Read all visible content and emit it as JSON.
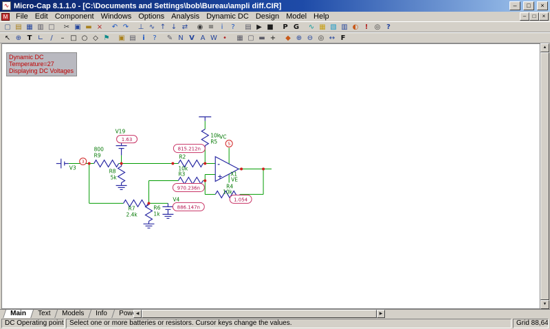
{
  "window": {
    "title": "Micro-Cap 8.1.1.0 - [C:\\Documents and Settings\\bob\\Bureau\\ampli diff.CIR]",
    "icon_glyph": "∿",
    "child_icon_glyph": "M",
    "controls": {
      "minimize": "–",
      "restore": "□",
      "close": "×"
    }
  },
  "menu": {
    "items": [
      {
        "label": "File",
        "name": "menu-file"
      },
      {
        "label": "Edit",
        "name": "menu-edit"
      },
      {
        "label": "Component",
        "name": "menu-component"
      },
      {
        "label": "Windows",
        "name": "menu-windows"
      },
      {
        "label": "Options",
        "name": "menu-options"
      },
      {
        "label": "Analysis",
        "name": "menu-analysis"
      },
      {
        "label": "Dynamic DC",
        "name": "menu-dynamic-dc"
      },
      {
        "label": "Design",
        "name": "menu-design"
      },
      {
        "label": "Model",
        "name": "menu-model"
      },
      {
        "label": "Help",
        "name": "menu-help"
      }
    ]
  },
  "toolbar1": {
    "icons": [
      {
        "n": "new-circuit-icon",
        "g": "▢",
        "st": "color:#44618f",
        "cls": "tbi"
      },
      {
        "n": "open-file-icon",
        "g": "▤",
        "st": "color:#a8801c",
        "cls": "tbi"
      },
      {
        "n": "save-file-icon",
        "g": "▦",
        "st": "color:#24459c",
        "cls": "tbi"
      },
      {
        "n": "print-icon",
        "g": "▥",
        "st": "color:#5a5a66",
        "cls": "tbi"
      },
      {
        "n": "print-preview-icon",
        "g": "□",
        "st": "color:#5a5a66",
        "cls": "tbi"
      },
      {
        "n": "cut-icon",
        "g": "✂",
        "st": "color:#3a3a3a",
        "cls": "tbi gap"
      },
      {
        "n": "copy-icon",
        "g": "▣",
        "st": "color:#24459c",
        "cls": "tbi"
      },
      {
        "n": "paste-icon",
        "g": "▬",
        "st": "color:#a8801c",
        "cls": "tbi"
      },
      {
        "n": "clear-icon",
        "g": "×",
        "st": "color:#b22222",
        "cls": "tbi"
      },
      {
        "n": "undo-icon",
        "g": "↶",
        "st": "color:#1a56c4",
        "cls": "tbi gap"
      },
      {
        "n": "redo-icon",
        "g": "↷",
        "st": "color:#1a56c4",
        "cls": "tbi"
      },
      {
        "n": "ground-icon",
        "g": "⊥",
        "st": "color:#24459c",
        "cls": "tbi gap"
      },
      {
        "n": "sine-source-icon",
        "g": "∿",
        "st": "color:#24459c",
        "cls": "tbi"
      },
      {
        "n": "step-up-icon",
        "g": "↑",
        "st": "color:#24459c",
        "cls": "tbi"
      },
      {
        "n": "step-down-icon",
        "g": "↓",
        "st": "color:#24459c",
        "cls": "tbi"
      },
      {
        "n": "mirror-icon",
        "g": "⇄",
        "st": "color:#24459c",
        "cls": "tbi"
      },
      {
        "n": "find-icon",
        "g": "◉",
        "st": "color:#3a3a3a",
        "cls": "tbi gap"
      },
      {
        "n": "find-repeat-icon",
        "g": "≡",
        "st": "color:#3a3a3a",
        "cls": "tbi"
      },
      {
        "n": "info-mode-icon",
        "g": "i",
        "st": "color:#1a56c4",
        "cls": "tbi"
      },
      {
        "n": "help-mode-icon",
        "g": "?",
        "st": "color:#1a56c4",
        "cls": "tbi"
      },
      {
        "n": "analysis-limits-icon",
        "g": "▤",
        "st": "color:#5a5a66",
        "cls": "tbi gap"
      },
      {
        "n": "run-icon",
        "g": "▶",
        "st": "color:#1c1c1c",
        "cls": "tbi"
      },
      {
        "n": "stop-icon",
        "g": "■",
        "st": "color:#1c1c1c",
        "cls": "tbi"
      },
      {
        "n": "probe-icon",
        "g": "P",
        "st": "color:#111111;font-weight:bold",
        "cls": "tbi gap"
      },
      {
        "n": "go-icon",
        "g": "G",
        "st": "color:#111111;font-weight:bold",
        "cls": "tbi"
      },
      {
        "n": "waveform-icon",
        "g": "∿",
        "st": "color:#0a9a9a",
        "cls": "tbi gap"
      },
      {
        "n": "monte-carlo-icon",
        "g": "▦",
        "st": "color:#c8a018",
        "cls": "tbi"
      },
      {
        "n": "three-d-plot-icon",
        "g": "▧",
        "st": "color:#189ac8",
        "cls": "tbi"
      },
      {
        "n": "performance-icon",
        "g": "▥",
        "st": "color:#24459c",
        "cls": "tbi"
      },
      {
        "n": "animate-icon",
        "g": "◐",
        "st": "color:#c85818",
        "cls": "tbi"
      },
      {
        "n": "state-variables-icon",
        "g": "!",
        "st": "color:#b22222;font-weight:bold",
        "cls": "tbi"
      },
      {
        "n": "watch-icon",
        "g": "◎",
        "st": "color:#3a3a3a",
        "cls": "tbi"
      },
      {
        "n": "help-icon",
        "g": "?",
        "st": "color:#24459c;font-weight:bold",
        "cls": "tbi"
      }
    ]
  },
  "toolbar2": {
    "icons": [
      {
        "n": "select-mode-icon",
        "g": "↖",
        "st": "color:#111111",
        "cls": "tbi"
      },
      {
        "n": "component-mode-icon",
        "g": "⊕",
        "st": "color:#24459c",
        "cls": "tbi"
      },
      {
        "n": "text-mode-icon",
        "g": "T",
        "st": "color:#111111;font-weight:bold",
        "cls": "tbi"
      },
      {
        "n": "wire-mode-icon",
        "g": "∟",
        "st": "color:#24459c",
        "cls": "tbi"
      },
      {
        "n": "diagonal-wire-mode-icon",
        "g": "/",
        "st": "color:#24459c",
        "cls": "tbi"
      },
      {
        "n": "line-mode-icon",
        "g": "–",
        "st": "color:#111111",
        "cls": "tbi"
      },
      {
        "n": "rectangle-mode-icon",
        "g": "□",
        "st": "color:#111111",
        "cls": "tbi"
      },
      {
        "n": "ellipse-mode-icon",
        "g": "○",
        "st": "color:#111111",
        "cls": "tbi"
      },
      {
        "n": "polygon-mode-icon",
        "g": "◇",
        "st": "color:#111111",
        "cls": "tbi"
      },
      {
        "n": "flag-mode-icon",
        "g": "⚑",
        "st": "color:#0a8a8a",
        "cls": "tbi"
      },
      {
        "n": "picture-mode-icon",
        "g": "▣",
        "st": "color:#a8801c",
        "cls": "tbi gap"
      },
      {
        "n": "scale-mode-icon",
        "g": "▤",
        "st": "color:#5a5a66",
        "cls": "tbi"
      },
      {
        "n": "info-icon",
        "g": "i",
        "st": "color:#1a56c4;font-weight:bold",
        "cls": "tbi"
      },
      {
        "n": "help-point-icon",
        "g": "?",
        "st": "color:#1a56c4",
        "cls": "tbi"
      },
      {
        "n": "point-to-point-icon",
        "g": "✎",
        "st": "color:#5a5a66",
        "cls": "tbi gap"
      },
      {
        "n": "node-numbers-icon",
        "g": "N",
        "st": "color:#24459c",
        "cls": "tbi"
      },
      {
        "n": "node-voltages-icon",
        "g": "V",
        "st": "color:#24459c;font-weight:bold",
        "cls": "tbi"
      },
      {
        "n": "current-display-icon",
        "g": "A",
        "st": "color:#24459c",
        "cls": "tbi"
      },
      {
        "n": "power-display-icon",
        "g": "W",
        "st": "color:#24459c",
        "cls": "tbi"
      },
      {
        "n": "pin-connections-icon",
        "g": "•",
        "st": "color:#b22222",
        "cls": "tbi"
      },
      {
        "n": "grid-toggle-icon",
        "g": "▦",
        "st": "color:#5a5a66",
        "cls": "tbi gap"
      },
      {
        "n": "border-toggle-icon",
        "g": "▢",
        "st": "color:#5a5a66",
        "cls": "tbi"
      },
      {
        "n": "title-block-icon",
        "g": "▬",
        "st": "color:#5a5a66",
        "cls": "tbi"
      },
      {
        "n": "crosshair-icon",
        "g": "+",
        "st": "color:#111111",
        "cls": "tbi"
      },
      {
        "n": "color-palette-icon",
        "g": "◆",
        "st": "color:#c85818",
        "cls": "tbi gap"
      },
      {
        "n": "zoom-in-icon",
        "g": "⊕",
        "st": "color:#24459c",
        "cls": "tbi"
      },
      {
        "n": "zoom-out-icon",
        "g": "⊖",
        "st": "color:#24459c",
        "cls": "tbi"
      },
      {
        "n": "magnify-icon",
        "g": "◎",
        "st": "color:#3a3a3a",
        "cls": "tbi"
      },
      {
        "n": "pan-icon",
        "g": "↔",
        "st": "color:#24459c",
        "cls": "tbi"
      },
      {
        "n": "font-icon",
        "g": "F",
        "st": "color:#111111;font-weight:bold",
        "cls": "tbi"
      }
    ]
  },
  "info_box": {
    "lines": [
      "Dynamic DC",
      "Temperature=27",
      "Displaying DC Voltages"
    ]
  },
  "schematic": {
    "colors": {
      "wire": "#009b00",
      "component": "#2929a3",
      "attr_text": "#007700",
      "value_text": "#b41450",
      "node": "#d02020"
    },
    "parts": {
      "v3": {
        "name": "V3"
      },
      "node3": {
        "label": "3"
      },
      "r9": {
        "value": "800",
        "name": "R9"
      },
      "v19": {
        "name": "V19",
        "display": "1.63"
      },
      "r8": {
        "name": "R8",
        "value": "5k"
      },
      "r5": {
        "value": "10k",
        "name": "R5"
      },
      "r2": {
        "name": "R2",
        "display": "815.212n"
      },
      "r3": {
        "value": "10k",
        "name": "R3",
        "display": "970.236n"
      },
      "opamp": {
        "name": "X1",
        "minus": "-",
        "plus": "+"
      },
      "vc": {
        "name": "VC",
        "node": "5"
      },
      "ve": {
        "name": "VE"
      },
      "r4": {
        "name": "R4",
        "value": "10k",
        "display": "1.054"
      },
      "r7": {
        "name": "R7",
        "value": "2.4k"
      },
      "r6": {
        "name": "R6",
        "value": "1k"
      },
      "v4": {
        "name": "V4",
        "display": "886.147n"
      }
    }
  },
  "tabs": {
    "items": [
      {
        "label": "Main",
        "name": "tab-main",
        "cls": "tab active"
      },
      {
        "label": "Text",
        "name": "tab-text",
        "cls": "tab"
      },
      {
        "label": "Models",
        "name": "tab-models",
        "cls": "tab"
      },
      {
        "label": "Info",
        "name": "tab-info",
        "cls": "tab"
      },
      {
        "label": "Power Supplies",
        "name": "tab-power-supplies",
        "cls": "tab"
      }
    ]
  },
  "status": {
    "left": "DC Operating point",
    "message": "Select one or more batteries or resistors. Cursor keys change the values.",
    "grid": "Grid 88,64"
  }
}
